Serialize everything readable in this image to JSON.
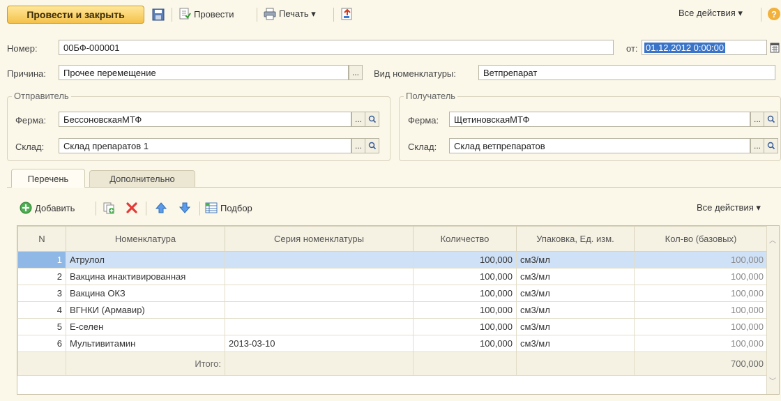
{
  "toolbar": {
    "post_close": "Провести и закрыть",
    "post": "Провести",
    "print": "Печать ▾",
    "all_actions": "Все действия ▾",
    "help": "?"
  },
  "header": {
    "number_label": "Номер:",
    "number_value": "00БФ-000001",
    "date_label": "от:",
    "date_value": "01.12.2012  0:00:00",
    "reason_label": "Причина:",
    "reason_value": "Прочее перемещение",
    "nomen_type_label": "Вид номенклатуры:",
    "nomen_type_value": "Ветпрепарат",
    "ellipsis": "..."
  },
  "sender": {
    "title": "Отправитель",
    "farm_label": "Ферма:",
    "farm_value": "БессоновскаяМТФ",
    "warehouse_label": "Склад:",
    "warehouse_value": "Склад препаратов 1"
  },
  "receiver": {
    "title": "Получатель",
    "farm_label": "Ферма:",
    "farm_value": "ЩетиновскаяМТФ",
    "warehouse_label": "Склад:",
    "warehouse_value": "Склад ветпрепаратов"
  },
  "tabs": [
    "Перечень",
    "Дополнительно"
  ],
  "table_toolbar": {
    "add": "Добавить",
    "pick": "Подбор",
    "all_actions": "Все действия ▾"
  },
  "table": {
    "columns": [
      "N",
      "Номенклатура",
      "Серия номенклатуры",
      "Количество",
      "Упаковка, Ед. изм.",
      "Кол-во (базовых)"
    ],
    "rows": [
      {
        "n": "1",
        "name": "Атрулол",
        "series": "",
        "qty": "100,000",
        "unit": "см3/мл",
        "base": "100,000"
      },
      {
        "n": "2",
        "name": "Вакцина инактивированная",
        "series": "",
        "qty": "100,000",
        "unit": "см3/мл",
        "base": "100,000"
      },
      {
        "n": "3",
        "name": "Вакцина ОКЗ",
        "series": "",
        "qty": "100,000",
        "unit": "см3/мл",
        "base": "100,000"
      },
      {
        "n": "4",
        "name": "ВГНКИ (Армавир)",
        "series": "",
        "qty": "100,000",
        "unit": "см3/мл",
        "base": "100,000"
      },
      {
        "n": "5",
        "name": "Е-селен",
        "series": "",
        "qty": "100,000",
        "unit": "см3/мл",
        "base": "100,000"
      },
      {
        "n": "6",
        "name": "Мультивитамин",
        "series": "2013-03-10",
        "qty": "100,000",
        "unit": "см3/мл",
        "base": "100,000"
      }
    ],
    "total_label": "Итого:",
    "total_value": "700,000"
  }
}
